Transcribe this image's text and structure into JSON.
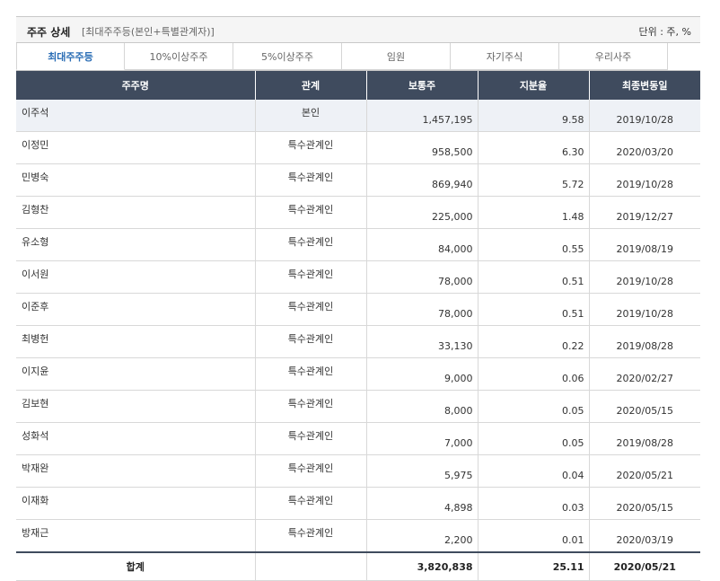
{
  "header": {
    "title": "주주 상세",
    "subtitle": "[최대주주등(본인+특별관계자)]",
    "unit": "단위 : 주, %"
  },
  "tabs": [
    {
      "label": "최대주주등",
      "active": true
    },
    {
      "label": "10%이상주주",
      "active": false
    },
    {
      "label": "5%이상주주",
      "active": false
    },
    {
      "label": "임원",
      "active": false
    },
    {
      "label": "자기주식",
      "active": false
    },
    {
      "label": "우리사주",
      "active": false
    }
  ],
  "table": {
    "columns": [
      "주주명",
      "관계",
      "보통주",
      "지분율",
      "최종변동일"
    ],
    "rows": [
      {
        "name": "이주석",
        "relation": "본인",
        "shares": "1,457,195",
        "ratio": "9.58",
        "date": "2019/10/28"
      },
      {
        "name": "이정민",
        "relation": "특수관계인",
        "shares": "958,500",
        "ratio": "6.30",
        "date": "2020/03/20"
      },
      {
        "name": "민병숙",
        "relation": "특수관계인",
        "shares": "869,940",
        "ratio": "5.72",
        "date": "2019/10/28"
      },
      {
        "name": "김형찬",
        "relation": "특수관계인",
        "shares": "225,000",
        "ratio": "1.48",
        "date": "2019/12/27"
      },
      {
        "name": "유소형",
        "relation": "특수관계인",
        "shares": "84,000",
        "ratio": "0.55",
        "date": "2019/08/19"
      },
      {
        "name": "이서원",
        "relation": "특수관계인",
        "shares": "78,000",
        "ratio": "0.51",
        "date": "2019/10/28"
      },
      {
        "name": "이준후",
        "relation": "특수관계인",
        "shares": "78,000",
        "ratio": "0.51",
        "date": "2019/10/28"
      },
      {
        "name": "최병헌",
        "relation": "특수관계인",
        "shares": "33,130",
        "ratio": "0.22",
        "date": "2019/08/28"
      },
      {
        "name": "이지윤",
        "relation": "특수관계인",
        "shares": "9,000",
        "ratio": "0.06",
        "date": "2020/02/27"
      },
      {
        "name": "김보현",
        "relation": "특수관계인",
        "shares": "8,000",
        "ratio": "0.05",
        "date": "2020/05/15"
      },
      {
        "name": "성화석",
        "relation": "특수관계인",
        "shares": "7,000",
        "ratio": "0.05",
        "date": "2019/08/28"
      },
      {
        "name": "박재완",
        "relation": "특수관계인",
        "shares": "5,975",
        "ratio": "0.04",
        "date": "2020/05/21"
      },
      {
        "name": "이재화",
        "relation": "특수관계인",
        "shares": "4,898",
        "ratio": "0.03",
        "date": "2020/05/15"
      },
      {
        "name": "방재근",
        "relation": "특수관계인",
        "shares": "2,200",
        "ratio": "0.01",
        "date": "2020/03/19"
      }
    ],
    "total": {
      "label": "합계",
      "shares": "3,820,838",
      "ratio": "25.11",
      "date": "2020/05/21"
    }
  },
  "colors": {
    "header_bg": "#3f4b5e",
    "active_tab": "#2a6db5",
    "highlight_row": "#eef1f6"
  }
}
